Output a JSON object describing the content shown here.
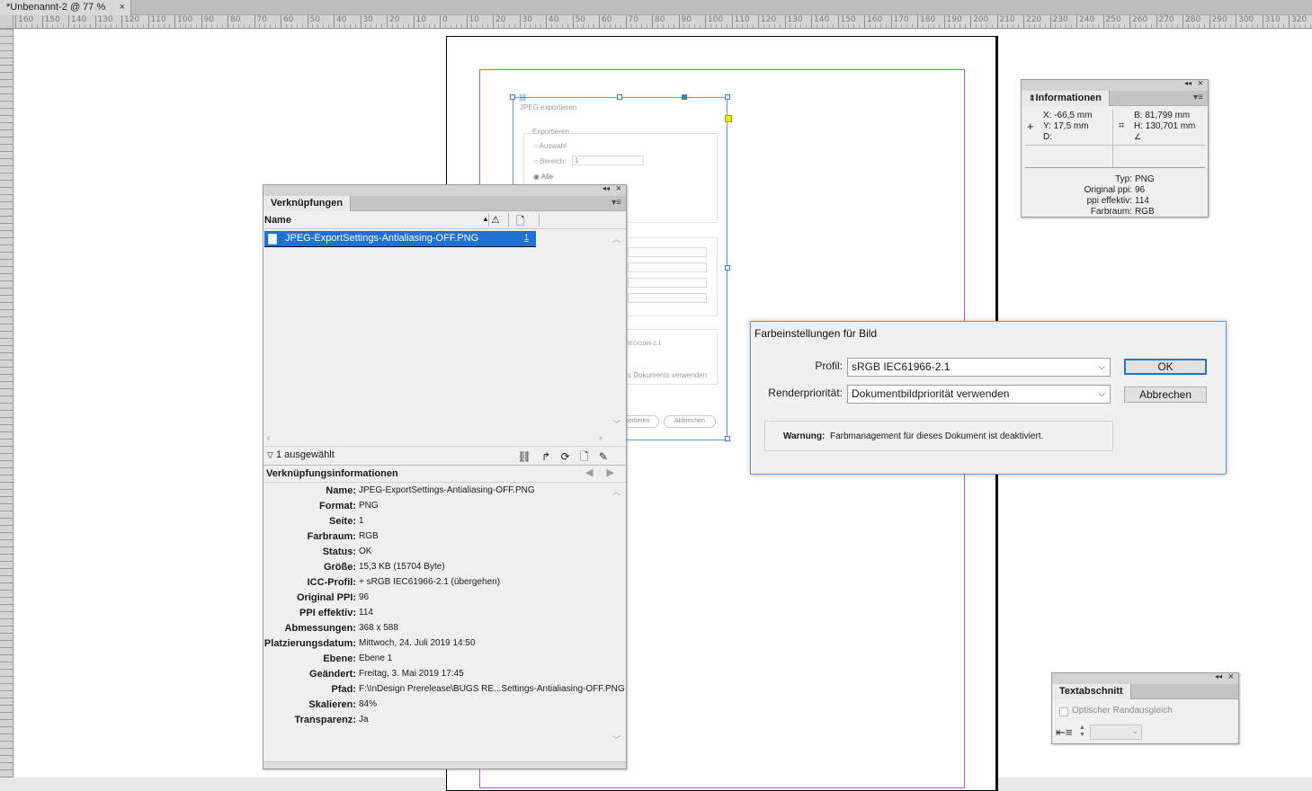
{
  "document_tab": {
    "title": "*Unbenannt-2 @ 77 %",
    "close": "×"
  },
  "ruler": {
    "labels": [
      "160",
      "150",
      "140",
      "130",
      "120",
      "110",
      "100",
      "90",
      "80",
      "70",
      "60",
      "50",
      "40",
      "30",
      "20",
      "10",
      "0",
      "10",
      "20",
      "30",
      "40",
      "50",
      "60",
      "70",
      "80",
      "90",
      "100",
      "110",
      "120",
      "130",
      "140",
      "150",
      "160",
      "170",
      "180",
      "190",
      "200",
      "210",
      "220",
      "230",
      "240",
      "250",
      "260",
      "270",
      "280",
      "290",
      "300",
      "310",
      "320"
    ]
  },
  "placed_image": {
    "title": "JPEG exportieren",
    "group": "Exportieren",
    "options": [
      "Auswahl",
      "Bereich:",
      "Alle"
    ],
    "range_value": "1",
    "profile_snippet": "IEC61966-2.1",
    "doc_snippet": "s Dokuments verwenden",
    "buttons": [
      "Exportieren",
      "Abbrechen"
    ]
  },
  "links_panel": {
    "tab": "Verknüpfungen",
    "column_name": "Name",
    "sort_glyph": "▲",
    "warning_glyph": "⚠",
    "page_glyph": "🗋",
    "selected_file": "JPEG-ExportSettings-Antialiasing-OFF.PNG",
    "selected_page": "1",
    "status_label": "1 ausgewählt",
    "status_icons": "⛓ ↱ ⟳ 🗋 ✎",
    "info_header": "Verknüpfungsinformationen",
    "info_nav": "◀ ▶",
    "info": [
      {
        "key": "Name:",
        "value": "JPEG-ExportSettings-Antialiasing-OFF.PNG"
      },
      {
        "key": "Format:",
        "value": "PNG"
      },
      {
        "key": "Seite:",
        "value": "1"
      },
      {
        "key": "Farbraum:",
        "value": "RGB"
      },
      {
        "key": "Status:",
        "value": "OK"
      },
      {
        "key": "Größe:",
        "value": "15,3 KB (15704 Byte)"
      },
      {
        "key": "ICC-Profil:",
        "value": "+ sRGB IEC61966-2.1 (übergehen)"
      },
      {
        "key": "Original PPI:",
        "value": "96"
      },
      {
        "key": "PPI effektiv:",
        "value": "114"
      },
      {
        "key": "Abmessungen:",
        "value": "368 x 588"
      },
      {
        "key": "Platzierungsdatum:",
        "value": "Mittwoch, 24. Juli 2019 14:50"
      },
      {
        "key": "Ebene:",
        "value": "Ebene 1"
      },
      {
        "key": "Geändert:",
        "value": "Freitag, 3. Mai 2019 17:45"
      },
      {
        "key": "Pfad:",
        "value": "F:\\InDesign Prerelease\\BUGS RE...Settings-Antialiasing-OFF.PNG"
      },
      {
        "key": "Skalieren:",
        "value": "84%"
      },
      {
        "key": "Transparenz:",
        "value": "Ja"
      }
    ]
  },
  "info_panel": {
    "tab": "Informationen",
    "x": "X: -66,5 mm",
    "y": "Y: 17,5 mm",
    "d": "D:",
    "b": "B: 81,799 mm",
    "h": "H: 130,701 mm",
    "meta": [
      {
        "key": "Typ:",
        "value": "PNG"
      },
      {
        "key": "Original ppi:",
        "value": "96"
      },
      {
        "key": "ppi effektiv:",
        "value": "114"
      },
      {
        "key": "Farbraum:",
        "value": "RGB"
      }
    ]
  },
  "text_panel": {
    "tab": "Textabschnitt",
    "checkbox_label": "Optischer Randausgleich",
    "size_value": ""
  },
  "dialog": {
    "title": "Farbeinstellungen für Bild",
    "profile_label": "Profil:",
    "profile_value": "sRGB IEC61966-2.1",
    "render_label": "Renderpriorität:",
    "render_value": "Dokumentbildpriorität verwenden",
    "ok": "OK",
    "cancel": "Abbrechen",
    "warning_label": "Warnung:",
    "warning_text": "Farbmanagement für dieses Dokument ist deaktiviert."
  },
  "colors": {
    "accent": "#1f71d4",
    "margin": "#b458d4",
    "selection_frame": "#5b9bd5",
    "handle_yellow": "#f2e31a"
  }
}
